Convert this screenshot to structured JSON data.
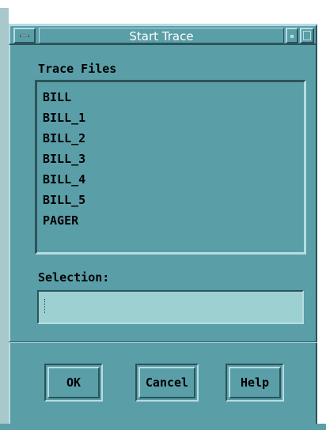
{
  "window": {
    "title": "Start Trace",
    "menu_icon": "window-menu-icon",
    "minimize_icon": "minimize-icon",
    "maximize_icon": "maximize-icon"
  },
  "trace_files": {
    "label": "Trace Files",
    "items": [
      "BILL",
      "BILL_1",
      "BILL_2",
      "BILL_3",
      "BILL_4",
      "BILL_5",
      "PAGER"
    ]
  },
  "selection": {
    "label": "Selection:",
    "value": ""
  },
  "buttons": {
    "ok": "OK",
    "cancel": "Cancel",
    "help": "Help"
  },
  "colors": {
    "background": "#5a9ea8",
    "highlight": "#b6dde2",
    "shadow": "#2c5458",
    "field": "#9dd0d0"
  }
}
